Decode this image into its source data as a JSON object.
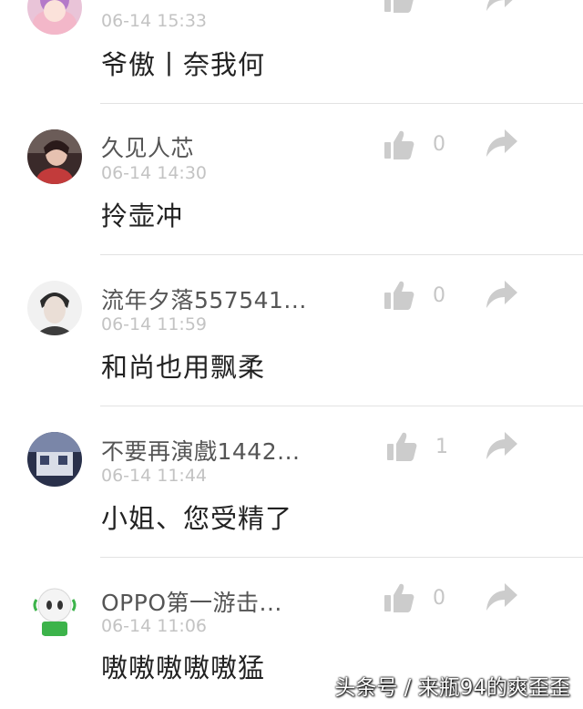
{
  "comments": [
    {
      "username": "",
      "time": "06-14 15:33",
      "content": "爷傲丨奈我何",
      "likes": "",
      "avatar": "avatar-pink-hair"
    },
    {
      "username": "久见人芯",
      "time": "06-14 14:30",
      "content": "拎壶冲",
      "likes": "0",
      "avatar": "avatar-woman-car"
    },
    {
      "username": "流年夕落557541...",
      "time": "06-14 11:59",
      "content": "和尚也用飘柔",
      "likes": "0",
      "avatar": "avatar-man-portrait"
    },
    {
      "username": "不要再演戲1442...",
      "time": "06-14 11:44",
      "content": "小姐、您受精了",
      "likes": "1",
      "avatar": "avatar-street-scene"
    },
    {
      "username": "OPPO第一游击...",
      "time": "06-14 11:06",
      "content": "嗷嗷嗷嗷嗷猛",
      "likes": "0",
      "avatar": "avatar-green-robot"
    }
  ],
  "watermark": "头条号 / 来瓶94的爽歪歪",
  "colors": {
    "icon_gray": "#cccccc",
    "timestamp": "#c3c3c3",
    "divider": "#e2e2e2"
  },
  "icons": {
    "like": "thumbs-up-icon",
    "share": "share-arrow-icon"
  }
}
